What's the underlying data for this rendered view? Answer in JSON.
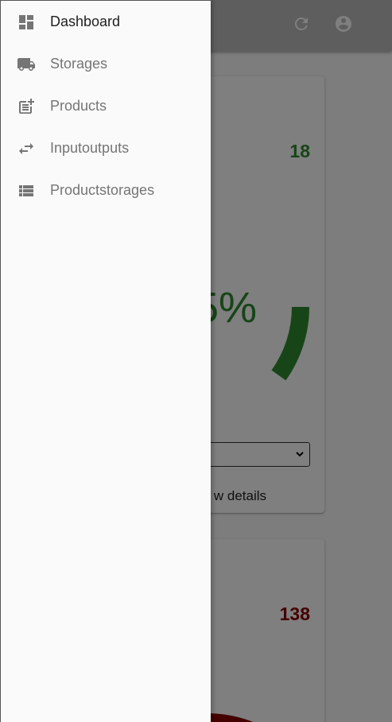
{
  "colors": {
    "accent_green": "#2e8b2e",
    "accent_red": "#8b0000",
    "icon_grey": "#757575",
    "active_text": "#212121"
  },
  "drawer": {
    "items": [
      {
        "label": "Dashboard",
        "icon": "dashboard-icon",
        "active": true
      },
      {
        "label": "Storages",
        "icon": "truck-icon",
        "active": false
      },
      {
        "label": "Products",
        "icon": "post-add-icon",
        "active": false
      },
      {
        "label": "Inputoutputs",
        "icon": "swap-arrows-icon",
        "active": false
      },
      {
        "label": "Productstorages",
        "icon": "view-list-icon",
        "active": false
      }
    ]
  },
  "appbar": {
    "icons": [
      "refresh-icon",
      "account-circle-icon"
    ]
  },
  "cards": [
    {
      "count": "18",
      "percent_text": "5%",
      "view_details": "w details",
      "gauge_color": "#2e8b2e"
    },
    {
      "count": "138",
      "gauge_color": "#8b0000"
    }
  ]
}
